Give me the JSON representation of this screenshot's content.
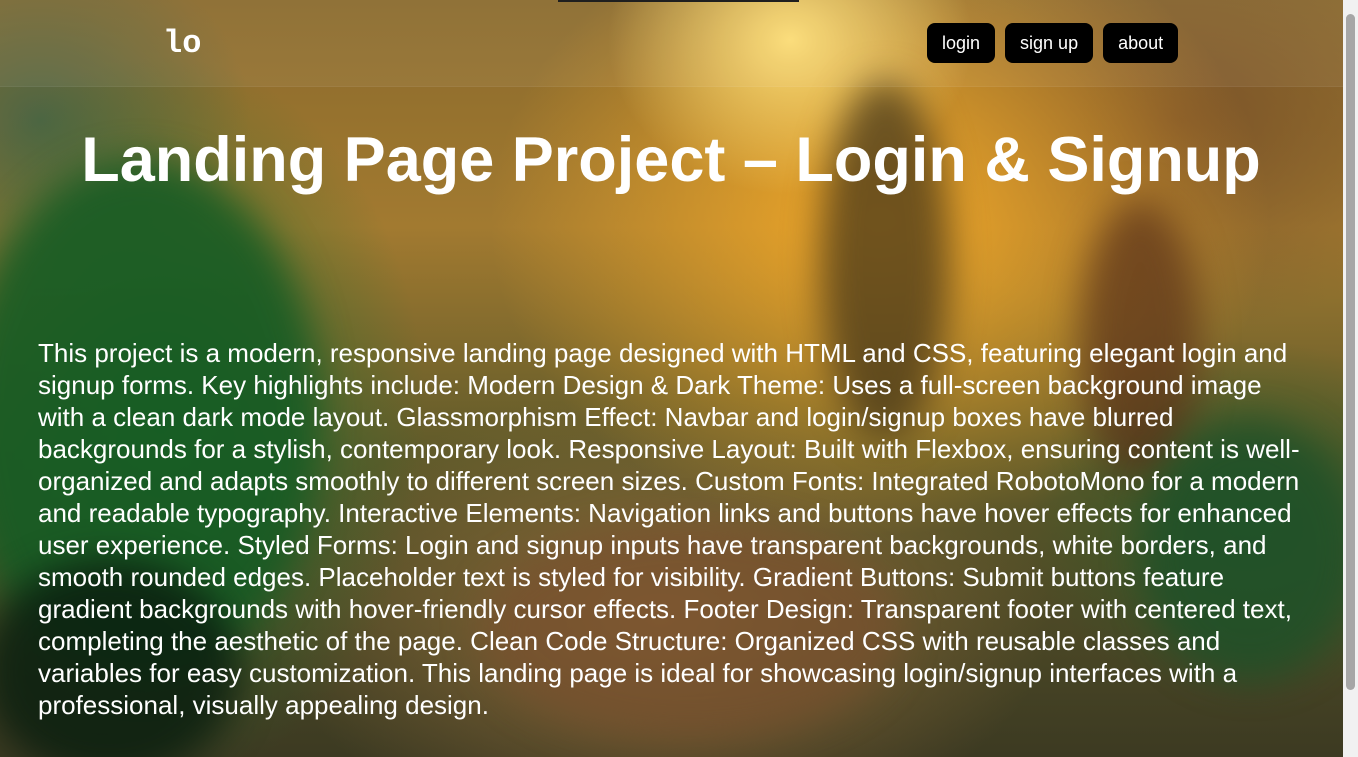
{
  "navbar": {
    "logo": "lo",
    "links": [
      {
        "label": "login"
      },
      {
        "label": "sign up"
      },
      {
        "label": "about"
      }
    ]
  },
  "hero": {
    "title": "Landing Page Project – Login & Signup",
    "description": "This project is a modern, responsive landing page designed with HTML and CSS, featuring elegant login and signup forms. Key highlights include: Modern Design & Dark Theme: Uses a full-screen background image with a clean dark mode layout. Glassmorphism Effect: Navbar and login/signup boxes have blurred backgrounds for a stylish, contemporary look. Responsive Layout: Built with Flexbox, ensuring content is well-organized and adapts smoothly to different screen sizes. Custom Fonts: Integrated RobotoMono for a modern and readable typography. Interactive Elements: Navigation links and buttons have hover effects for enhanced user experience. Styled Forms: Login and signup inputs have transparent backgrounds, white borders, and smooth rounded edges. Placeholder text is styled for visibility. Gradient Buttons: Submit buttons feature gradient backgrounds with hover-friendly cursor effects. Footer Design: Transparent footer with centered text, completing the aesthetic of the page. Clean Code Structure: Organized CSS with reusable classes and variables for easy customization. This landing page is ideal for showcasing login/signup interfaces with a professional, visually appealing design."
  },
  "colors": {
    "nav_button_bg": "#000000",
    "text": "#ffffff",
    "sky_glow": "#f5aa28",
    "foliage": "#286e2d"
  }
}
